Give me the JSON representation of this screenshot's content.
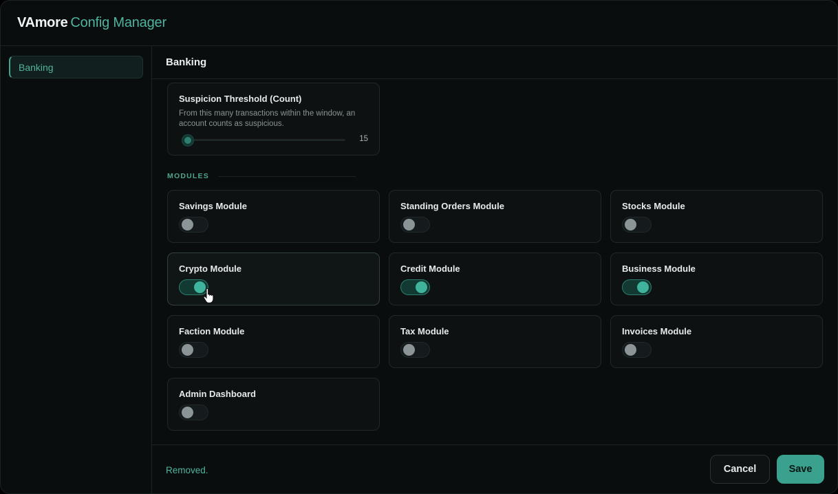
{
  "app": {
    "name": "VAmore",
    "subtitle": "Config Manager"
  },
  "sidebar": {
    "items": [
      {
        "label": "Banking",
        "active": true
      }
    ]
  },
  "main": {
    "title": "Banking",
    "threshold": {
      "title": "Suspicion Threshold (Count)",
      "description": "From this many transactions within the window, an account counts as suspicious.",
      "value": "15",
      "slider_fraction": 0.0
    },
    "modules_label": "MODULES",
    "modules": [
      {
        "label": "Savings Module",
        "enabled": false
      },
      {
        "label": "Standing Orders Module",
        "enabled": false
      },
      {
        "label": "Stocks Module",
        "enabled": false
      },
      {
        "label": "Crypto Module",
        "enabled": true
      },
      {
        "label": "Credit Module",
        "enabled": true
      },
      {
        "label": "Business Module",
        "enabled": true
      },
      {
        "label": "Faction Module",
        "enabled": false
      },
      {
        "label": "Tax Module",
        "enabled": false
      },
      {
        "label": "Invoices Module",
        "enabled": false
      },
      {
        "label": "Admin Dashboard",
        "enabled": false
      }
    ]
  },
  "footer": {
    "status": "Removed.",
    "cancel_label": "Cancel",
    "save_label": "Save"
  },
  "colors": {
    "accent": "#3aa18e",
    "accent_text": "#4fb39f",
    "background": "#0a0d0e"
  },
  "icons": {
    "cursor": "hand-pointer-icon"
  }
}
